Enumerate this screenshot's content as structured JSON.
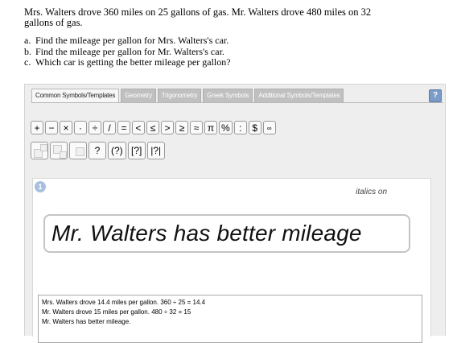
{
  "problem": {
    "text": "Mrs. Walters drove 360 miles on 25 gallons of gas. Mr. Walters drove 480 miles on 32 gallons of gas.",
    "items": [
      {
        "marker": "a.",
        "text": "Find the mileage per gallon for Mrs. Walters's car."
      },
      {
        "marker": "b.",
        "text": "Find the mileage per gallon for Mr. Walters's car."
      },
      {
        "marker": "c.",
        "text": "Which car is getting the better mileage per gallon?"
      }
    ]
  },
  "tabs": [
    "Common Symbols/Templates",
    "Geometry",
    "Trigonometry",
    "Greek Symbols",
    "Additional Symbols/Templates"
  ],
  "help_label": "?",
  "symbols": [
    "+",
    "−",
    "×",
    "·",
    "÷",
    "/",
    "=",
    "<",
    "≤",
    ">",
    "≥",
    "≈",
    "π",
    "%",
    ":",
    "$",
    "∞"
  ],
  "templates_text": [
    "?",
    "(?)",
    "[?]",
    "|?|"
  ],
  "step_number": "1",
  "italics_label": "italics on",
  "answer": "Mr. Walters has better mileage",
  "work_lines": [
    "Mrs. Walters drove 14.4 miles per gallon. 360 ÷ 25 = 14.4",
    "Mr. Walters drove 15 miles per gallon. 480 ÷ 32 = 15",
    "Mr. Walters has better mileage."
  ],
  "colors": {
    "panel": "#eeeeee",
    "tab_inactive": "#c0c0c0",
    "help": "#7a9cc6",
    "badge": "#a8c0de"
  }
}
